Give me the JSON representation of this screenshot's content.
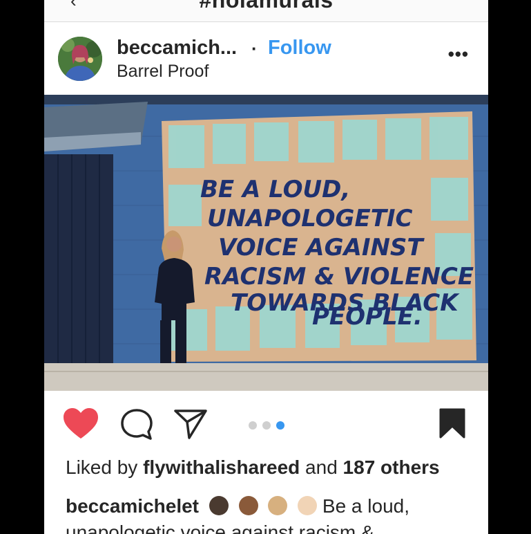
{
  "header": {
    "title": "#nolamurals",
    "back_glyph": "‹"
  },
  "post": {
    "username": "beccamich...",
    "separator": "·",
    "follow_label": "Follow",
    "location": "Barrel Proof",
    "more_glyph": "•••",
    "image": {
      "mural_lines": [
        "BE A LOUD,",
        "UNAPOLOGETIC",
        "VOICE AGAINST",
        "RACISM & VIOLENCE",
        "TOWARDS BLACK",
        "PEOPLE."
      ]
    },
    "carousel": {
      "count": 3,
      "active_index": 2
    },
    "likes": {
      "prefix": "Liked by",
      "user": "flywithalishareed",
      "middle": "and",
      "others": "187 others"
    },
    "caption": {
      "username": "beccamichelet",
      "text": "Be a loud,",
      "text_line2": "unapologetic voice against racism &"
    }
  },
  "colors": {
    "accent": "#3897f0",
    "like": "#ed4956",
    "text": "#262626"
  },
  "icons": [
    "heart-icon",
    "comment-icon",
    "share-icon",
    "bookmark-icon",
    "more-icon",
    "back-icon"
  ]
}
